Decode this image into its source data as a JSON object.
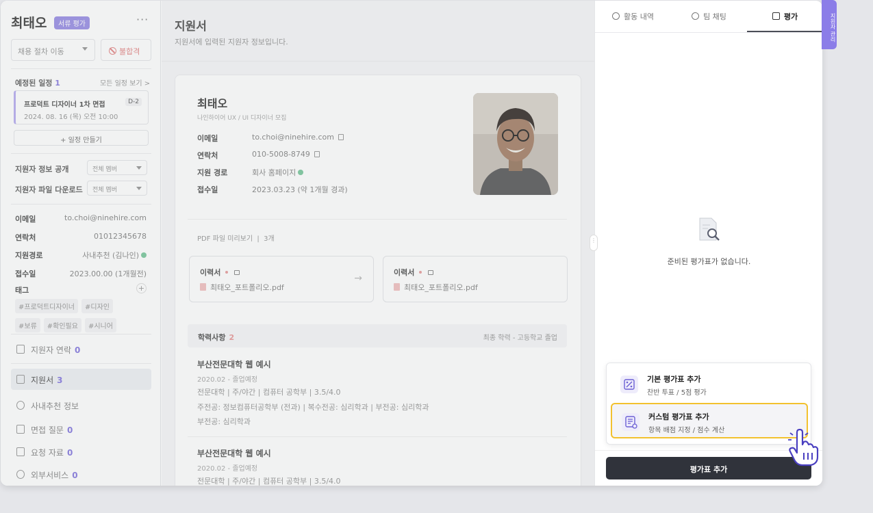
{
  "sidebar": {
    "name": "최태오",
    "badge": "서류 평가",
    "more": "···",
    "process_select": "채용 절차 이동",
    "reject": "불합격",
    "schedule_label": "예정된 일정",
    "schedule_count": "1",
    "schedule_all": "모든 일정 보기 >",
    "schedule_card": {
      "title": "프로덕트 디자이너 1차 면접",
      "date": "2024. 08. 16 (목) 오전 10:00",
      "dday": "D-2"
    },
    "make_schedule": "+ 일정 만들기",
    "share_label": "지원자 정보 공개",
    "share_value": "전체 멤버",
    "download_label": "지원자 파일 다운로드",
    "download_value": "전체 멤버",
    "info": {
      "email_k": "이메일",
      "email_v": "to.choi@ninehire.com",
      "phone_k": "연락처",
      "phone_v": "01012345678",
      "route_k": "지원경로",
      "route_v": "사내추천 (김나인)",
      "date_k": "접수일",
      "date_v": "2023.00.00 (1개월전)"
    },
    "tags_label": "태그",
    "tags": [
      "#프로덕트디자이너",
      "#디자인",
      "#보류",
      "#확인필요",
      "#시니어"
    ],
    "nav": [
      {
        "label": "지원자 연락",
        "count": "0"
      },
      {
        "label": "지원서",
        "count": "3"
      },
      {
        "label": "사내추천 정보",
        "count": ""
      },
      {
        "label": "면접 질문",
        "count": "0"
      },
      {
        "label": "요청 자료",
        "count": "0"
      },
      {
        "label": "외부서비스",
        "count": "0"
      }
    ]
  },
  "main": {
    "title": "지원서",
    "subtitle": "지원서에 입력된 지원자 정보입니다.",
    "name": "최태오",
    "position": "나인하이어 UX / UI 디자이너 모집",
    "rows": [
      {
        "k": "이메일",
        "v": "to.choi@ninehire.com"
      },
      {
        "k": "연락처",
        "v": "010-5008-8749"
      },
      {
        "k": "지원 경로",
        "v": "회사 홈페이지"
      },
      {
        "k": "접수일",
        "v": "2023.03.23 (약 1개월 경과)"
      }
    ],
    "pdf_header": "PDF 파일 미리보기",
    "pdf_count": "3개",
    "pdf_cards": [
      {
        "title": "이력서",
        "file": "최태오_포트폴리오.pdf"
      },
      {
        "title": "이력서",
        "file": "최태오_포트폴리오.pdf"
      }
    ],
    "edu_title": "학력사항",
    "edu_count": "2",
    "edu_right": "최종 학력 - 고등학교 졸업",
    "school1": {
      "name": "부산전문대학 웹 예시",
      "period": "2020.02 - 졸업예정",
      "line1": "전문대학 | 주/야간 | 컴퓨터 공학부 | 3.5/4.0",
      "line2": "주전공: 정보컴퓨터공학부 (전과) | 복수전공: 심리학과 | 부전공: 심리학과",
      "line3": "부전공: 심리학과"
    },
    "school2": {
      "name": "부산전문대학 웹 예시",
      "period": "2020.02 - 졸업예정",
      "line1": "전문대학 | 주/야간 | 컴퓨터 공학부 | 3.5/4.0"
    }
  },
  "panel": {
    "tabs": [
      "활동 내역",
      "팀 채팅",
      "평가"
    ],
    "side_tab": "지원자 관리",
    "empty_text": "준비된 평가표가 없습니다.",
    "options": [
      {
        "title": "기본 평가표 추가",
        "desc": "찬반 투표 / 5점 평가"
      },
      {
        "title": "커스텀 평가표 추가",
        "desc": "항목 배점 지정 / 점수 계산"
      }
    ],
    "add_button": "평가표 추가"
  },
  "colors": {
    "accent": "#8b7de8",
    "highlight": "#f2c12e",
    "dark_button": "#30333b"
  }
}
